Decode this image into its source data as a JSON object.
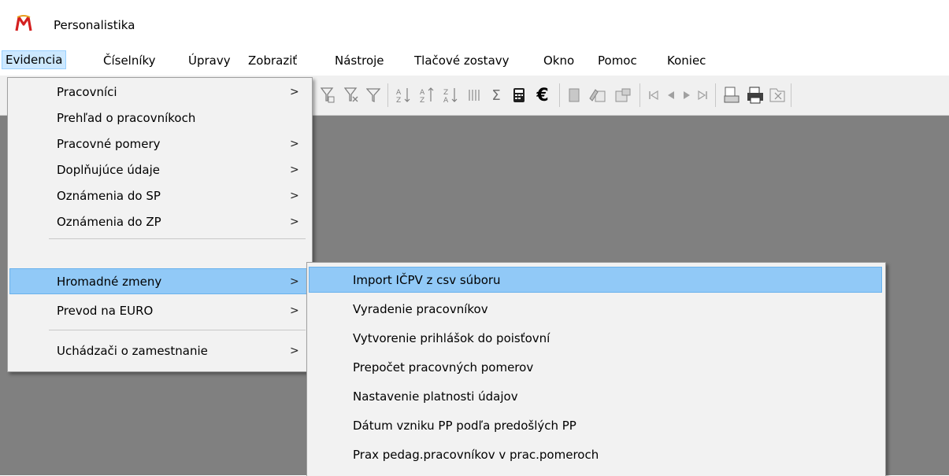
{
  "window": {
    "title": "Personalistika",
    "icon": "app-logo-icon"
  },
  "menubar": {
    "items": [
      "Evidencia",
      "Číselníky",
      "Úpravy",
      "Zobraziť",
      "Nástroje",
      "Tlačové zostavy",
      "Okno",
      "Pomoc",
      "Koniec"
    ],
    "active": "Evidencia"
  },
  "toolbar": {
    "icons": [
      "filter-icon",
      "clear-filter-icon",
      "funnel-icon",
      "sort-ascending-icon",
      "sort-descending-icon",
      "sort-custom-icon",
      "columns-icon",
      "sum-icon",
      "calculator-icon",
      "euro-icon",
      "document-icon",
      "edit-icon",
      "properties-icon",
      "first-record-icon",
      "previous-record-icon",
      "next-record-icon",
      "last-record-icon",
      "print-preview-icon",
      "print-icon",
      "export-icon"
    ],
    "sum_glyph": "Σ",
    "euro_glyph": "€"
  },
  "evidencia_menu": {
    "items": [
      {
        "label": "Pracovníci",
        "submenu": true
      },
      {
        "label": "Prehľad o pracovníkoch",
        "submenu": false
      },
      {
        "label": "Pracovné pomery",
        "submenu": true
      },
      {
        "label": "Doplňujúce údaje",
        "submenu": true
      },
      {
        "label": "Oznámenia do SP",
        "submenu": true
      },
      {
        "label": "Oznámenia do ZP",
        "submenu": true
      },
      {
        "label": "Hromadné zmeny",
        "submenu": true,
        "highlighted": true
      },
      {
        "label": "Prevod na EURO",
        "submenu": true
      },
      {
        "label": "Uchádzači o zamestnanie",
        "submenu": true
      }
    ],
    "submenu_arrow": ">"
  },
  "hromadne_zmeny_menu": {
    "items": [
      {
        "label": "Import IČPV z csv súboru",
        "highlighted": true
      },
      {
        "label": "Vyradenie pracovníkov"
      },
      {
        "label": "Vytvorenie prihlášok do poisťovní"
      },
      {
        "label": "Prepočet pracovných pomerov"
      },
      {
        "label": "Nastavenie platnosti údajov"
      },
      {
        "label": "Dátum vzniku PP podľa predošlých PP"
      },
      {
        "label": "Prax pedag.pracovníkov v prac.pomeroch"
      }
    ]
  }
}
